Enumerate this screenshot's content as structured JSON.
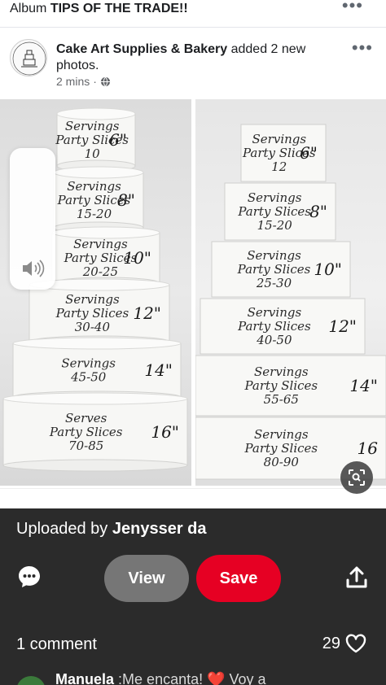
{
  "album": {
    "prefix": "Album",
    "title": "TIPS OF THE TRADE!!"
  },
  "post": {
    "page_name": "Cake Art Supplies & Bakery",
    "action": "added 2 new photos.",
    "time": "2 mins",
    "separator": "·",
    "privacy_icon": "globe-icon"
  },
  "photo_left": {
    "tiers": [
      {
        "lines": [
          "Servings",
          "Party Slices",
          "10"
        ],
        "size": "6\""
      },
      {
        "lines": [
          "Servings",
          "Party Slices",
          "15-20"
        ],
        "size": "8\""
      },
      {
        "lines": [
          "Servings",
          "Party Slices",
          "20-25"
        ],
        "size": "10\""
      },
      {
        "lines": [
          "Servings",
          "Party Slices",
          "30-40"
        ],
        "size": "12\""
      },
      {
        "lines": [
          "Servings",
          "45-50"
        ],
        "size": "14\""
      },
      {
        "lines": [
          "Serves",
          "Party Slices",
          "70-85"
        ],
        "size": "16\""
      }
    ]
  },
  "photo_right": {
    "tiers": [
      {
        "lines": [
          "Servings",
          "Party Slices",
          "12"
        ],
        "size": "6\""
      },
      {
        "lines": [
          "Servings",
          "Party Slices",
          "15-20"
        ],
        "size": "8\""
      },
      {
        "lines": [
          "Servings",
          "Party Slices",
          "25-30"
        ],
        "size": "10\""
      },
      {
        "lines": [
          "Servings",
          "Party Slices",
          "40-50"
        ],
        "size": "12\""
      },
      {
        "lines": [
          "Servings",
          "Party Slices",
          "55-65"
        ],
        "size": "14\""
      },
      {
        "lines": [
          "Servings",
          "Party Slices",
          "80-90"
        ],
        "size": "16"
      }
    ]
  },
  "sheet": {
    "uploaded_prefix": "Uploaded by",
    "uploader": "Jenysser da",
    "view_label": "View",
    "save_label": "Save",
    "comment_count": "1 comment",
    "likes": "29",
    "preview": {
      "name": "Manuela",
      "text": ":Me encanta! ❤️ Voy a"
    }
  },
  "colors": {
    "save": "#e60023",
    "sheet_bg": "#2b2b2b",
    "view": "#767676"
  },
  "icons": [
    "more-dots-icon",
    "globe-icon",
    "speaker-icon",
    "lens-search-icon",
    "comment-bubble-icon",
    "share-upload-icon",
    "heart-outline-icon"
  ]
}
